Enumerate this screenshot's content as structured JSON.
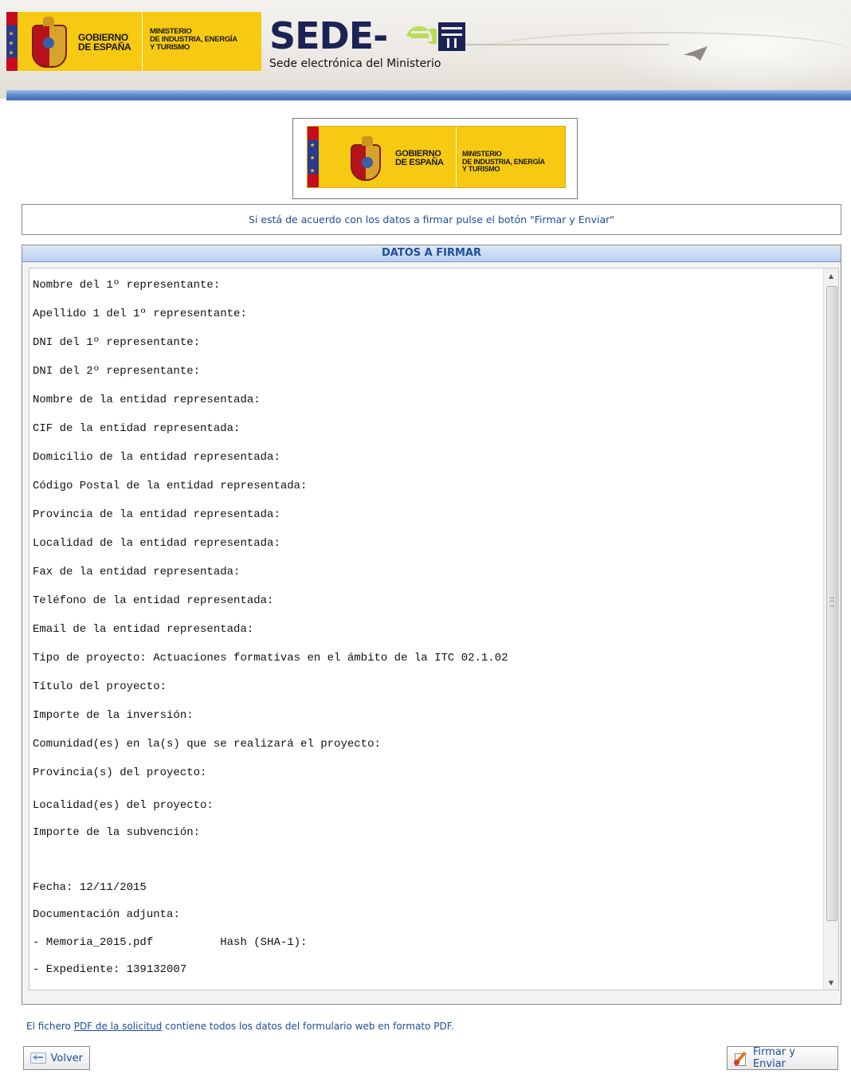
{
  "header": {
    "gov_line1": "GOBIERNO",
    "gov_line2": "DE ESPAÑA",
    "ministry_line1": "MINISTERIO",
    "ministry_line2": "DE INDUSTRIA, ENERGÍA",
    "ministry_line3": "Y TURISMO",
    "sede_title": "SEDE-",
    "sede_subtitle": "Sede electrónica del Ministerio"
  },
  "logo": {
    "gov_line1": "GOBIERNO",
    "gov_line2": "DE ESPAÑA",
    "ministry_line1": "MINISTERIO",
    "ministry_line2": "DE INDUSTRIA, ENERGÍA",
    "ministry_line3": "Y TURISMO"
  },
  "notice": "Si está de acuerdo con los datos a firmar pulse el botón \"Firmar y Enviar\"",
  "panel": {
    "title": "DATOS A FIRMAR",
    "lines": [
      "Nombre del 1º representante:",
      "Apellido 1 del 1º representante:",
      "DNI del 1º representante:",
      "DNI del 2º representante:",
      "Nombre de la entidad representada:",
      "CIF de la entidad representada:",
      "Domicilio de la entidad representada:",
      "Código Postal de la entidad representada:",
      "Provincia de la entidad representada:",
      "Localidad de la entidad representada:",
      "Fax de la entidad representada:",
      "Teléfono de la entidad representada:",
      "Email de la entidad representada:",
      "Tipo de proyecto: Actuaciones formativas en el ámbito de la ITC 02.1.02",
      "Título del proyecto:",
      "Importe de la inversión:",
      "Comunidad(es) en la(s) que se realizará el proyecto:",
      "Provincia(s) del proyecto:",
      "Localidad(es) del proyecto:",
      "Importe de la subvención:",
      "",
      "Fecha: 12/11/2015",
      "Documentación adjunta:",
      "- Memoria_2015.pdf          Hash (SHA-1):",
      "- Expediente: 139132007"
    ]
  },
  "footer": {
    "pdf_prefix": "El fichero ",
    "pdf_link": "PDF de la solicitud",
    "pdf_suffix": " contiene todos los datos del formulario web en formato PDF.",
    "back_label": "Volver",
    "sign_label": "Firmar y Enviar"
  },
  "icons": {
    "back": "arrow-left-icon",
    "sign": "sign-document-icon",
    "scroll_up": "triangle-up",
    "scroll_down": "triangle-down"
  },
  "colors": {
    "link_blue": "#1f4d9a",
    "gov_yellow": "#f6c913",
    "header_bar_blue": "#3f6cb6"
  }
}
